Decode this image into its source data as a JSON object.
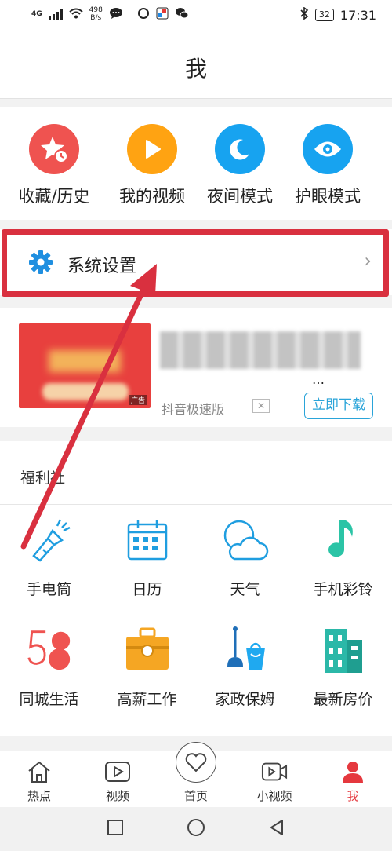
{
  "status_bar": {
    "network": "4G",
    "speed_value": "498",
    "speed_unit": "B/s",
    "battery": "32",
    "time": "17:31"
  },
  "title": "我",
  "quick_actions": [
    {
      "label": "收藏/历史",
      "icon": "star-clock-icon",
      "color": "#ef5350"
    },
    {
      "label": "我的视频",
      "icon": "play-icon",
      "color": "#ffa312"
    },
    {
      "label": "夜间模式",
      "icon": "moon-icon",
      "color": "#17a3f0"
    },
    {
      "label": "护眼模式",
      "icon": "eye-icon",
      "color": "#17a3f0"
    }
  ],
  "settings": {
    "label": "系统设置",
    "icon": "gear-icon",
    "chevron": "›"
  },
  "ad": {
    "source": "抖音极速版",
    "download_label": "立即下载",
    "ellipsis": "…",
    "close_label": "✕",
    "tag": "广告"
  },
  "welfare": {
    "title": "福利社",
    "items": [
      {
        "label": "手电筒",
        "icon": "flashlight-icon"
      },
      {
        "label": "日历",
        "icon": "calendar-icon"
      },
      {
        "label": "天气",
        "icon": "weather-icon"
      },
      {
        "label": "手机彩铃",
        "icon": "music-note-icon"
      },
      {
        "label": "同城生活",
        "icon": "58-logo-icon"
      },
      {
        "label": "高薪工作",
        "icon": "briefcase-icon"
      },
      {
        "label": "家政保姆",
        "icon": "cleaning-icon"
      },
      {
        "label": "最新房价",
        "icon": "building-icon"
      }
    ]
  },
  "tabbar": [
    {
      "label": "热点",
      "icon": "house-icon"
    },
    {
      "label": "视频",
      "icon": "video-icon"
    },
    {
      "label": "首页",
      "icon": "heart-icon"
    },
    {
      "label": "小视频",
      "icon": "camera-icon"
    },
    {
      "label": "我",
      "icon": "person-icon",
      "active": true
    }
  ],
  "colors": {
    "accent": "#e5383e",
    "blue": "#17a3f0",
    "highlight_frame": "#d9303f"
  }
}
